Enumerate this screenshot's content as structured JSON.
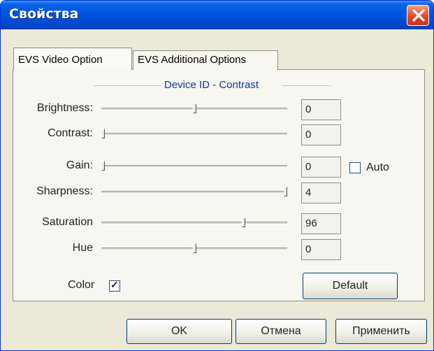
{
  "window": {
    "title": "Свойства"
  },
  "tabs": [
    {
      "label": "EVS Video Option",
      "active": true
    },
    {
      "label": "EVS Additional Options",
      "active": false
    }
  ],
  "group": {
    "title": "Device ID - Contrast"
  },
  "controls": [
    {
      "label": "Brightness:",
      "value": "0",
      "slider_fraction": 0.5
    },
    {
      "label": "Contrast:",
      "value": "0",
      "slider_fraction": 0.0
    },
    {
      "label": "Gain:",
      "value": "0",
      "slider_fraction": 0.0
    },
    {
      "label": "Sharpness:",
      "value": "4",
      "slider_fraction": 1.0
    },
    {
      "label": "Saturation",
      "value": "96",
      "slider_fraction": 0.77
    },
    {
      "label": "Hue",
      "value": "0",
      "slider_fraction": 0.5
    }
  ],
  "auto": {
    "label": "Auto",
    "checked": false
  },
  "color": {
    "label": "Color",
    "checked": true
  },
  "buttons": {
    "default": "Default",
    "ok": "OK",
    "cancel": "Отмена",
    "apply": "Применить"
  },
  "icons": {
    "close": "close-icon",
    "check": "checkmark-icon"
  }
}
